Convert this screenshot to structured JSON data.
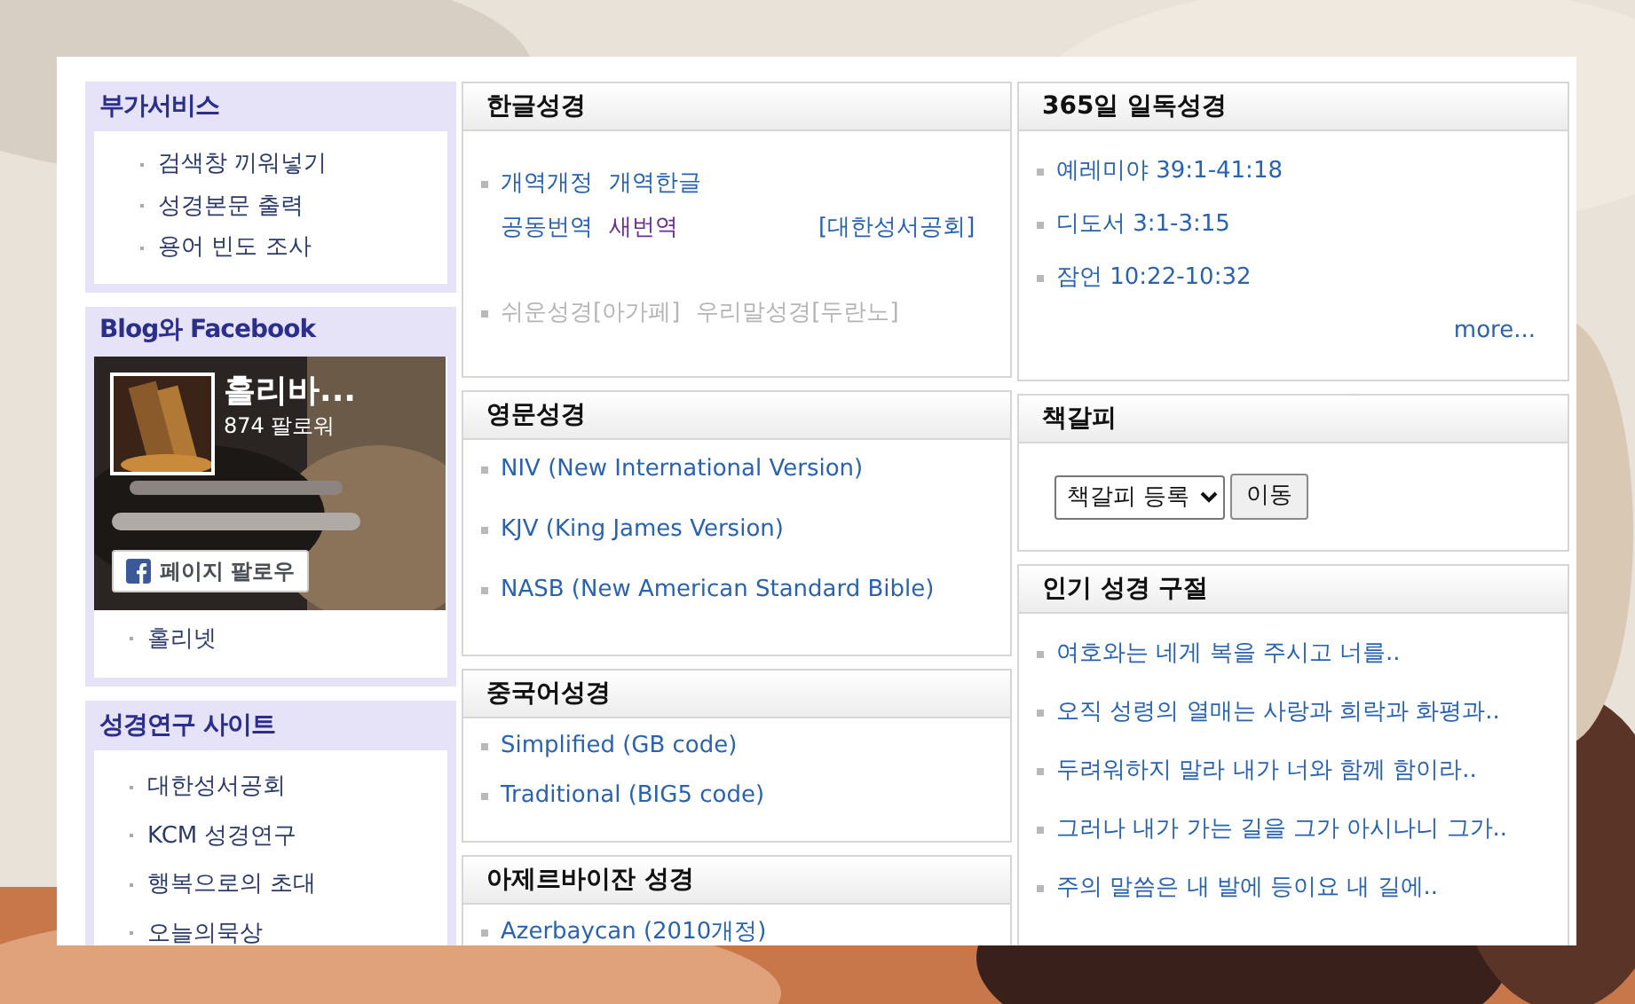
{
  "sidebar": [
    {
      "kind": "links",
      "title": "부가서비스",
      "items": [
        "검색창 끼워넣기",
        "성경본문 출력",
        "용어 빈도 조사"
      ]
    },
    {
      "kind": "facebook",
      "title": "Blog와 Facebook",
      "page_name": "홀리바...",
      "followers": "874 팔로워",
      "follow_button": "페이지 팔로우",
      "items": [
        "홀리넷"
      ]
    },
    {
      "kind": "links",
      "title": "성경연구 사이트",
      "items": [
        "대한성서공회",
        "KCM 성경연구",
        "행복으로의 초대",
        "오늘의묵상"
      ]
    }
  ],
  "middle": [
    {
      "title": "한글성경",
      "rows": [
        {
          "bullet": true,
          "links": [
            {
              "text": "개역개정",
              "visited": false,
              "disabled": false
            },
            {
              "text": "개역한글",
              "visited": false,
              "disabled": false
            }
          ]
        },
        {
          "bullet": false,
          "links": [
            {
              "text": "공동번역",
              "visited": false,
              "disabled": false
            },
            {
              "text": "새번역",
              "visited": true,
              "disabled": false
            }
          ],
          "note": "[대한성서공회]"
        },
        {
          "bullet": true,
          "links": [
            {
              "text": "쉬운성경[아가페]",
              "visited": false,
              "disabled": true
            },
            {
              "text": "우리말성경[두란노]",
              "visited": false,
              "disabled": true
            }
          ]
        }
      ]
    },
    {
      "title": "영문성경",
      "rows": [
        {
          "bullet": true,
          "links": [
            {
              "text": "NIV (New International Version)",
              "visited": false,
              "disabled": false
            }
          ]
        },
        {
          "bullet": true,
          "links": [
            {
              "text": "KJV (King James Version)",
              "visited": false,
              "disabled": false
            }
          ]
        },
        {
          "bullet": true,
          "links": [
            {
              "text": "NASB (New American Standard Bible)",
              "visited": false,
              "disabled": false
            }
          ]
        }
      ]
    },
    {
      "title": "중국어성경",
      "rows": [
        {
          "bullet": true,
          "links": [
            {
              "text": "Simplified (GB code)",
              "visited": false,
              "disabled": false
            }
          ]
        },
        {
          "bullet": true,
          "links": [
            {
              "text": "Traditional (BIG5 code)",
              "visited": false,
              "disabled": false
            }
          ]
        }
      ]
    },
    {
      "title": "아제르바이잔 성경",
      "rows": [
        {
          "bullet": true,
          "links": [
            {
              "text": "Azerbaycan (2010개정)",
              "visited": false,
              "disabled": false
            }
          ]
        }
      ]
    }
  ],
  "right": [
    {
      "kind": "list",
      "title": "365일 일독성경",
      "items": [
        "예레미야 39:1-41:18",
        "디도서 3:1-3:15",
        "잠언 10:22-10:32"
      ],
      "more": "more..."
    },
    {
      "kind": "bookmark",
      "title": "책갈피",
      "select": "책갈피 등록",
      "button": "이동"
    },
    {
      "kind": "list",
      "title": "인기 성경 구절",
      "items": [
        "여호와는 네게 복을 주시고 너를..",
        "오직 성령의 열매는 사랑과 희락과 화평과..",
        "두려워하지 말라 내가 너와 함께 함이라..",
        "그러나 내가 가는 길을 그가 아시나니 그가..",
        "주의 말씀은 내 발에 등이요 내 길에.."
      ]
    }
  ]
}
